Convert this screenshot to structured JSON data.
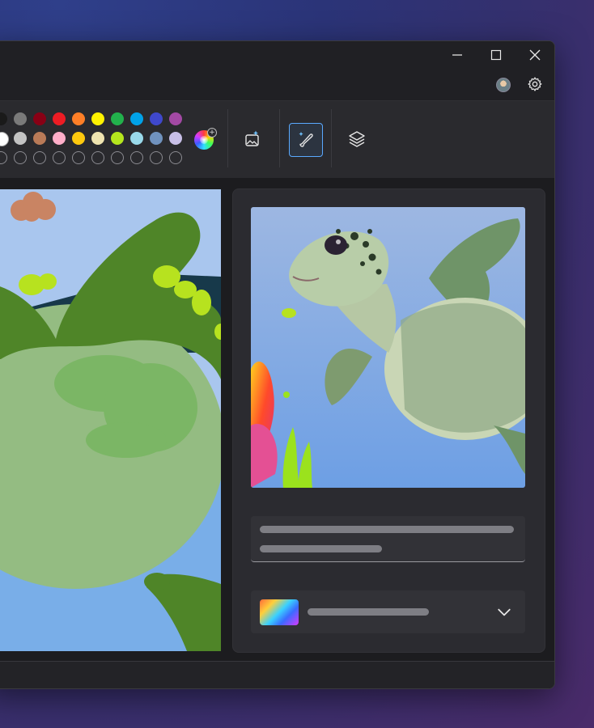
{
  "window": {
    "controls": [
      "minimize-icon",
      "maximize-icon",
      "close-icon"
    ],
    "header_icons": [
      "avatar",
      "gear-icon"
    ]
  },
  "palette": {
    "row1": [
      "#1a1a1a",
      "#7a7a7a",
      "#880015",
      "#ed1c24",
      "#ff7f27",
      "#fff200",
      "#22b14c",
      "#00a2e8",
      "#3f48cc",
      "#a349a4"
    ],
    "row2": [
      "#ffffff",
      "#c3c3c3",
      "#b97a57",
      "#ffaec9",
      "#ffc90e",
      "#efe4b0",
      "#b5e61d",
      "#99d9ea",
      "#7092be",
      "#c8bfe7"
    ],
    "row3_empty_count": 10
  },
  "tools": [
    "image-creator-icon",
    "cocreator-brush-icon",
    "layers-icon"
  ],
  "active_tool": "cocreator-brush-icon",
  "accent_color": "#5aa9ff",
  "panel": {
    "prompt_placeholder_lines": 2,
    "style_dropdown": {
      "icon": "chevron-down-icon"
    }
  }
}
